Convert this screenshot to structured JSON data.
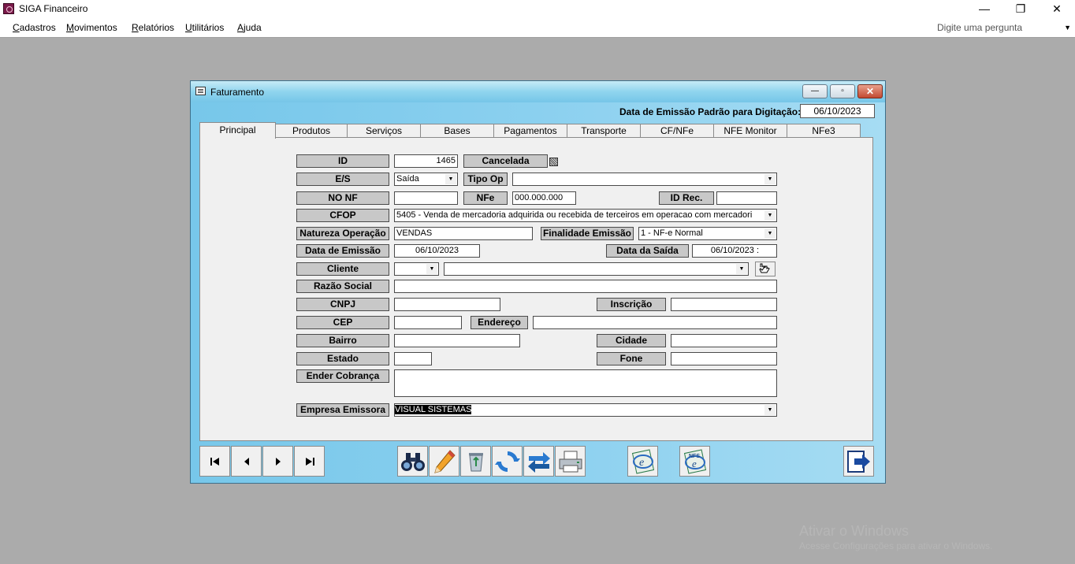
{
  "app": {
    "title": "SIGA Financeiro",
    "window_controls": {
      "minimize": "—",
      "restore": "❐",
      "close": "✕"
    }
  },
  "menu": {
    "items": [
      {
        "first": "C",
        "rest": "adastros"
      },
      {
        "first": "M",
        "rest": "ovimentos"
      },
      {
        "first": "R",
        "rest": "elatórios"
      },
      {
        "first": "U",
        "rest": "tilitários"
      },
      {
        "first": "A",
        "rest": "juda"
      }
    ],
    "ask_placeholder": "Digite uma pergunta"
  },
  "window": {
    "title": "Faturamento",
    "std_date_label": "Data de Emissão Padrão para Digitação:",
    "std_date_value": "06/10/2023"
  },
  "tabs": [
    "Principal",
    "Produtos",
    "Serviços",
    "Bases",
    "Pagamentos",
    "Transporte",
    "CF/NFe Vinculados",
    "NFE Monitor",
    "NFe3"
  ],
  "form": {
    "id_label": "ID",
    "id_value": "1465",
    "cancelada_label": "Cancelada",
    "es_label": "E/S",
    "es_value": "Saída",
    "tipoop_label": "Tipo Op",
    "tipoop_value": "",
    "nonf_label": "NO NF",
    "nonf_value": "",
    "nfe_label": "NFe",
    "nfe_value": "000.000.000",
    "idrec_label": "ID Rec.",
    "idrec_value": "",
    "cfop_label": "CFOP",
    "cfop_value": "5405 - Venda de mercadoria adquirida ou recebida de terceiros em operacao com mercadori",
    "natureza_label": "Natureza Operação",
    "natureza_value": "VENDAS",
    "finalidade_label": "Finalidade Emissão",
    "finalidade_value": "1 - NF-e Normal",
    "dataemissao_label": "Data de Emissão",
    "dataemissao_value": "06/10/2023",
    "datasaida_label": "Data da Saída",
    "datasaida_value": "06/10/2023   :",
    "cliente_label": "Cliente",
    "razao_label": "Razão Social",
    "cnpj_label": "CNPJ",
    "inscricao_label": "Inscrição",
    "cep_label": "CEP",
    "endereco_label": "Endereço",
    "bairro_label": "Bairro",
    "cidade_label": "Cidade",
    "estado_label": "Estado",
    "fone_label": "Fone",
    "endercobranca_label": "Ender Cobrança",
    "empresa_label": "Empresa Emissora",
    "empresa_value": "VISUAL SISTEMAS"
  },
  "watermark": {
    "line1": "Ativar o Windows",
    "line2": "Acesse Configurações para ativar o Windows."
  }
}
